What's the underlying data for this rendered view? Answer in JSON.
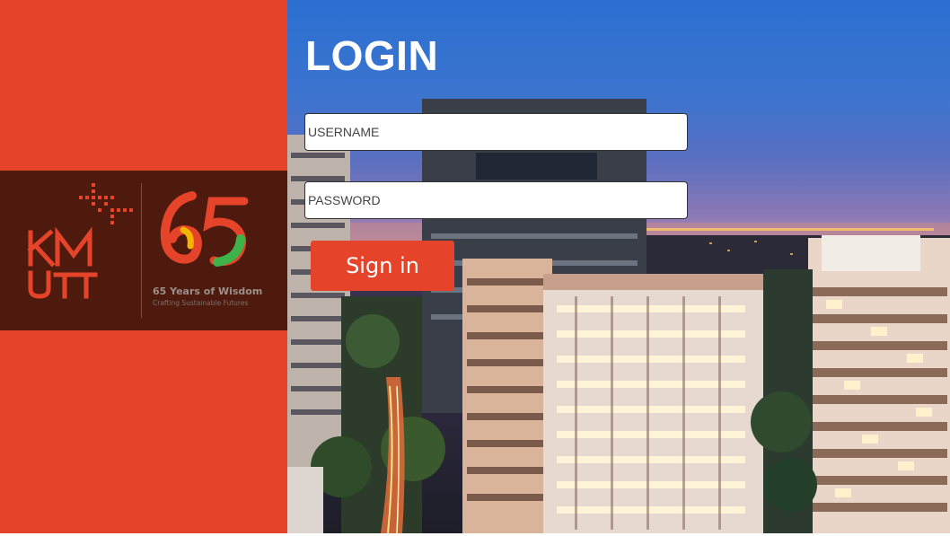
{
  "login": {
    "title": "LOGIN",
    "username_placeholder": "USERNAME",
    "password_placeholder": "PASSWORD",
    "signin_label": "Sign in"
  },
  "brand": {
    "logo_text": "KMUTT",
    "anniversary_number": "65",
    "anniversary_title": "65 Years of Wisdom",
    "anniversary_subtitle": "Crafting Sustainable Futures"
  },
  "colors": {
    "brand_orange": "#e5442a",
    "brand_dark": "#4e1a0e"
  }
}
